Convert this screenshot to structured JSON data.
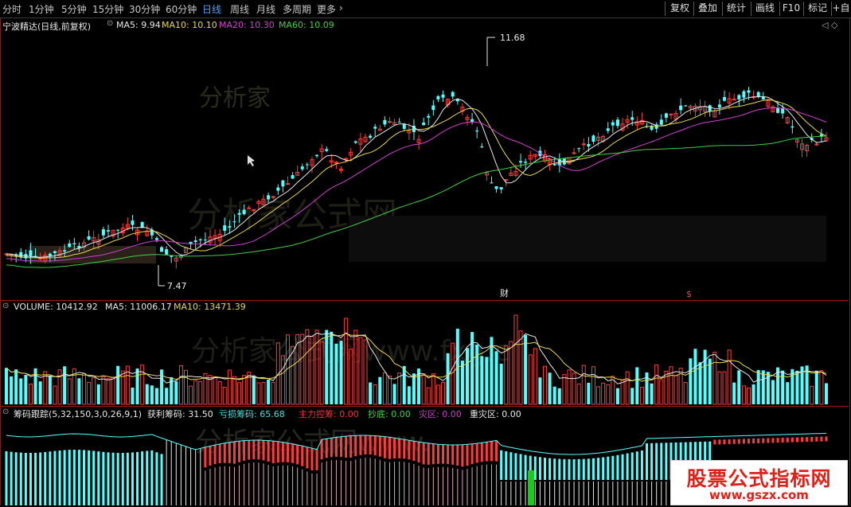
{
  "toolbar": {
    "periods": [
      "分时",
      "1分钟",
      "5分钟",
      "15分钟",
      "30分钟",
      "60分钟",
      "日线",
      "周线",
      "月线",
      "多周期",
      "更多"
    ],
    "active_period": "日线",
    "more_arrow": "›",
    "right_buttons": [
      "复权",
      "叠加",
      "统计",
      "画线",
      "F10",
      "标记",
      "+自"
    ]
  },
  "main_chart": {
    "stock_name": "宁波精达(日线,前复权)",
    "ma": [
      {
        "label": "MA5: 9.94",
        "color": "#e8e8e8"
      },
      {
        "label": "MA10: 10.10",
        "color": "#e8d84a"
      },
      {
        "label": "MA20: 10.30",
        "color": "#d040d0"
      },
      {
        "label": "MA60: 10.09",
        "color": "#40d040"
      }
    ],
    "high_label": "11.68",
    "low_label": "7.47",
    "event_markers": [
      "财",
      "$"
    ],
    "watermark": "分析家公式网"
  },
  "volume_chart": {
    "title": "VOLUME: 10412.92",
    "ma5": "MA5: 11006.17",
    "ma10": "MA10: 13471.39",
    "watermark": "分析家公式网www.fxg.c"
  },
  "indicator_chart": {
    "title": "筹码跟踪(5,32,150,3,0,26,9,1)",
    "items": [
      {
        "label": "获利筹码: 31.50",
        "color": "#e8e8e8"
      },
      {
        "label": "亏损筹码: 65.68",
        "color": "#40e0e0"
      },
      {
        "label": "主力控筹: 0.00",
        "color": "#ff3030"
      },
      {
        "label": "抄底: 0.00",
        "color": "#40d040"
      },
      {
        "label": "灾区: 0.00",
        "color": "#c040c0"
      },
      {
        "label": "重灾区: 0.00",
        "color": "#e8e8e8"
      }
    ],
    "watermark": "分析家公式网www."
  },
  "site_logo": {
    "title": "股票公式指标网",
    "url": "www.gszx.com"
  },
  "colors": {
    "up": "#ff3c3c",
    "down": "#54ffff",
    "frame": "#a01818",
    "accent": "#4aa3ff"
  }
}
